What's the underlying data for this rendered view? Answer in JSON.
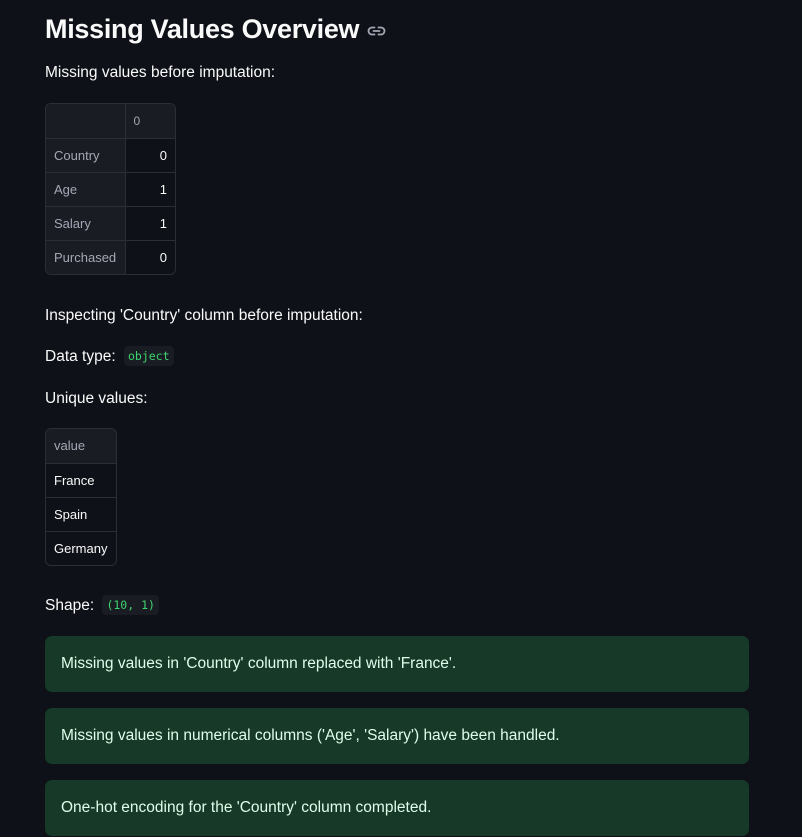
{
  "header": {
    "title": "Missing Values Overview"
  },
  "missing_section": {
    "heading": "Missing values before imputation:",
    "table": {
      "column_header": "0",
      "rows": [
        {
          "label": "Country",
          "value": "0"
        },
        {
          "label": "Age",
          "value": "1"
        },
        {
          "label": "Salary",
          "value": "1"
        },
        {
          "label": "Purchased",
          "value": "0"
        }
      ]
    }
  },
  "inspect_section": {
    "heading": "Inspecting 'Country' column before imputation:",
    "dtype_label": "Data type:",
    "dtype_value": "object",
    "unique_label": "Unique values:",
    "unique_table": {
      "column_header": "value",
      "rows": [
        "France",
        "Spain",
        "Germany"
      ]
    },
    "shape_label": "Shape:",
    "shape_value": "(10, 1)"
  },
  "alerts": [
    "Missing values in 'Country' column replaced with 'France'.",
    "Missing values in numerical columns ('Age', 'Salary') have been handled.",
    "One-hot encoding for the 'Country' column completed."
  ],
  "colors": {
    "background": "#0e1117",
    "success_bg": "#173928",
    "success_text": "#dffde9",
    "code_text": "#3dd56d"
  }
}
